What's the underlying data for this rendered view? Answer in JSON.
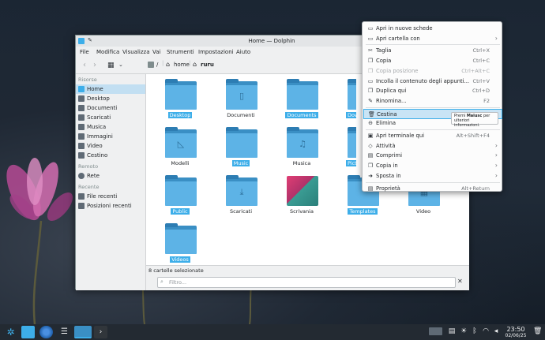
{
  "window": {
    "title": "Home — Dolphin"
  },
  "menubar": [
    "File",
    "Modifica",
    "Visualizza",
    "Vai",
    "Strumenti",
    "Impostazioni",
    "Aiuto"
  ],
  "breadcrumb": {
    "root": "/",
    "home": "home",
    "user": "ruru"
  },
  "sidebar": {
    "sections": [
      {
        "heading": "Risorse",
        "items": [
          {
            "label": "Home",
            "icon": "home-icon",
            "active": true
          },
          {
            "label": "Desktop",
            "icon": "desktop-icon"
          },
          {
            "label": "Documenti",
            "icon": "documents-icon"
          },
          {
            "label": "Scaricati",
            "icon": "download-icon"
          },
          {
            "label": "Musica",
            "icon": "music-icon"
          },
          {
            "label": "Immagini",
            "icon": "pictures-icon"
          },
          {
            "label": "Video",
            "icon": "video-icon"
          },
          {
            "label": "Cestino",
            "icon": "trash-icon"
          }
        ]
      },
      {
        "heading": "Remoto",
        "items": [
          {
            "label": "Rete",
            "icon": "network-icon"
          }
        ]
      },
      {
        "heading": "Recente",
        "items": [
          {
            "label": "File recenti",
            "icon": "recent-files-icon"
          },
          {
            "label": "Posizioni recenti",
            "icon": "recent-locations-icon"
          }
        ]
      }
    ]
  },
  "files": [
    {
      "name": "Desktop",
      "selected": true,
      "glyph": ""
    },
    {
      "name": "Documenti",
      "selected": false,
      "glyph": "▯"
    },
    {
      "name": "Documents",
      "selected": true,
      "glyph": ""
    },
    {
      "name": "Downloads",
      "selected": true,
      "glyph": ""
    },
    {
      "name": "Modelli",
      "selected": false,
      "glyph": "◺"
    },
    {
      "name": "Music",
      "selected": true,
      "glyph": ""
    },
    {
      "name": "Musica",
      "selected": false,
      "glyph": "♫"
    },
    {
      "name": "Pictures",
      "selected": true,
      "glyph": ""
    },
    {
      "name": "Public",
      "selected": true,
      "glyph": ""
    },
    {
      "name": "Scaricati",
      "selected": false,
      "glyph": "⤓"
    },
    {
      "name": "Scrivania",
      "selected": false,
      "glyph": ""
    },
    {
      "name": "Templates",
      "selected": true,
      "glyph": ""
    },
    {
      "name": "Video",
      "selected": false,
      "glyph": "▦"
    },
    {
      "name": "Videos",
      "selected": true,
      "glyph": ""
    }
  ],
  "status": {
    "text": "8 cartelle selezionate"
  },
  "filter": {
    "placeholder": "Filtro..."
  },
  "context_menu": {
    "items": [
      {
        "label": "Apri in nuove schede",
        "shortcut": "",
        "icon": "open-tabs-icon"
      },
      {
        "label": "Apri cartella con",
        "shortcut": "",
        "icon": "open-with-icon",
        "submenu": true
      },
      {
        "separator": true
      },
      {
        "label": "Taglia",
        "shortcut": "Ctrl+X",
        "icon": "cut-icon"
      },
      {
        "label": "Copia",
        "shortcut": "Ctrl+C",
        "icon": "copy-icon"
      },
      {
        "label": "Copia posizione",
        "shortcut": "Ctrl+Alt+C",
        "icon": "copy-location-icon",
        "disabled": true
      },
      {
        "label": "Incolla il contenuto degli appunti...",
        "shortcut": "Ctrl+V",
        "icon": "paste-icon"
      },
      {
        "label": "Duplica qui",
        "shortcut": "Ctrl+D",
        "icon": "duplicate-icon"
      },
      {
        "label": "Rinomina...",
        "shortcut": "F2",
        "icon": "rename-icon"
      },
      {
        "separator": true
      },
      {
        "label": "Cestina",
        "shortcut": "",
        "icon": "trash-icon",
        "highlighted": true
      },
      {
        "label": "Elimina",
        "shortcut": "",
        "icon": "delete-icon"
      },
      {
        "separator": true
      },
      {
        "label": "Apri terminale qui",
        "shortcut": "Alt+Shift+F4",
        "icon": "terminal-icon"
      },
      {
        "label": "Attività",
        "shortcut": "",
        "icon": "activities-icon",
        "submenu": true
      },
      {
        "label": "Comprimi",
        "shortcut": "",
        "icon": "compress-icon",
        "submenu": true
      },
      {
        "label": "Copia in",
        "shortcut": "",
        "icon": "copy-to-icon",
        "submenu": true
      },
      {
        "label": "Sposta in",
        "shortcut": "",
        "icon": "move-to-icon",
        "submenu": true
      },
      {
        "separator": true
      },
      {
        "label": "Proprietà",
        "shortcut": "Alt+Return",
        "icon": "properties-icon"
      }
    ]
  },
  "tooltip": {
    "prefix": "Premi ",
    "key": "Maiusc",
    "suffix": " per ulteriori informazioni."
  },
  "taskbar": {
    "time": "23:50",
    "date": "02/06/25"
  },
  "colors": {
    "accent": "#3daee9",
    "folder": "#5db3e6",
    "folder_dark": "#3a8fc4",
    "panel": "#232a32"
  }
}
